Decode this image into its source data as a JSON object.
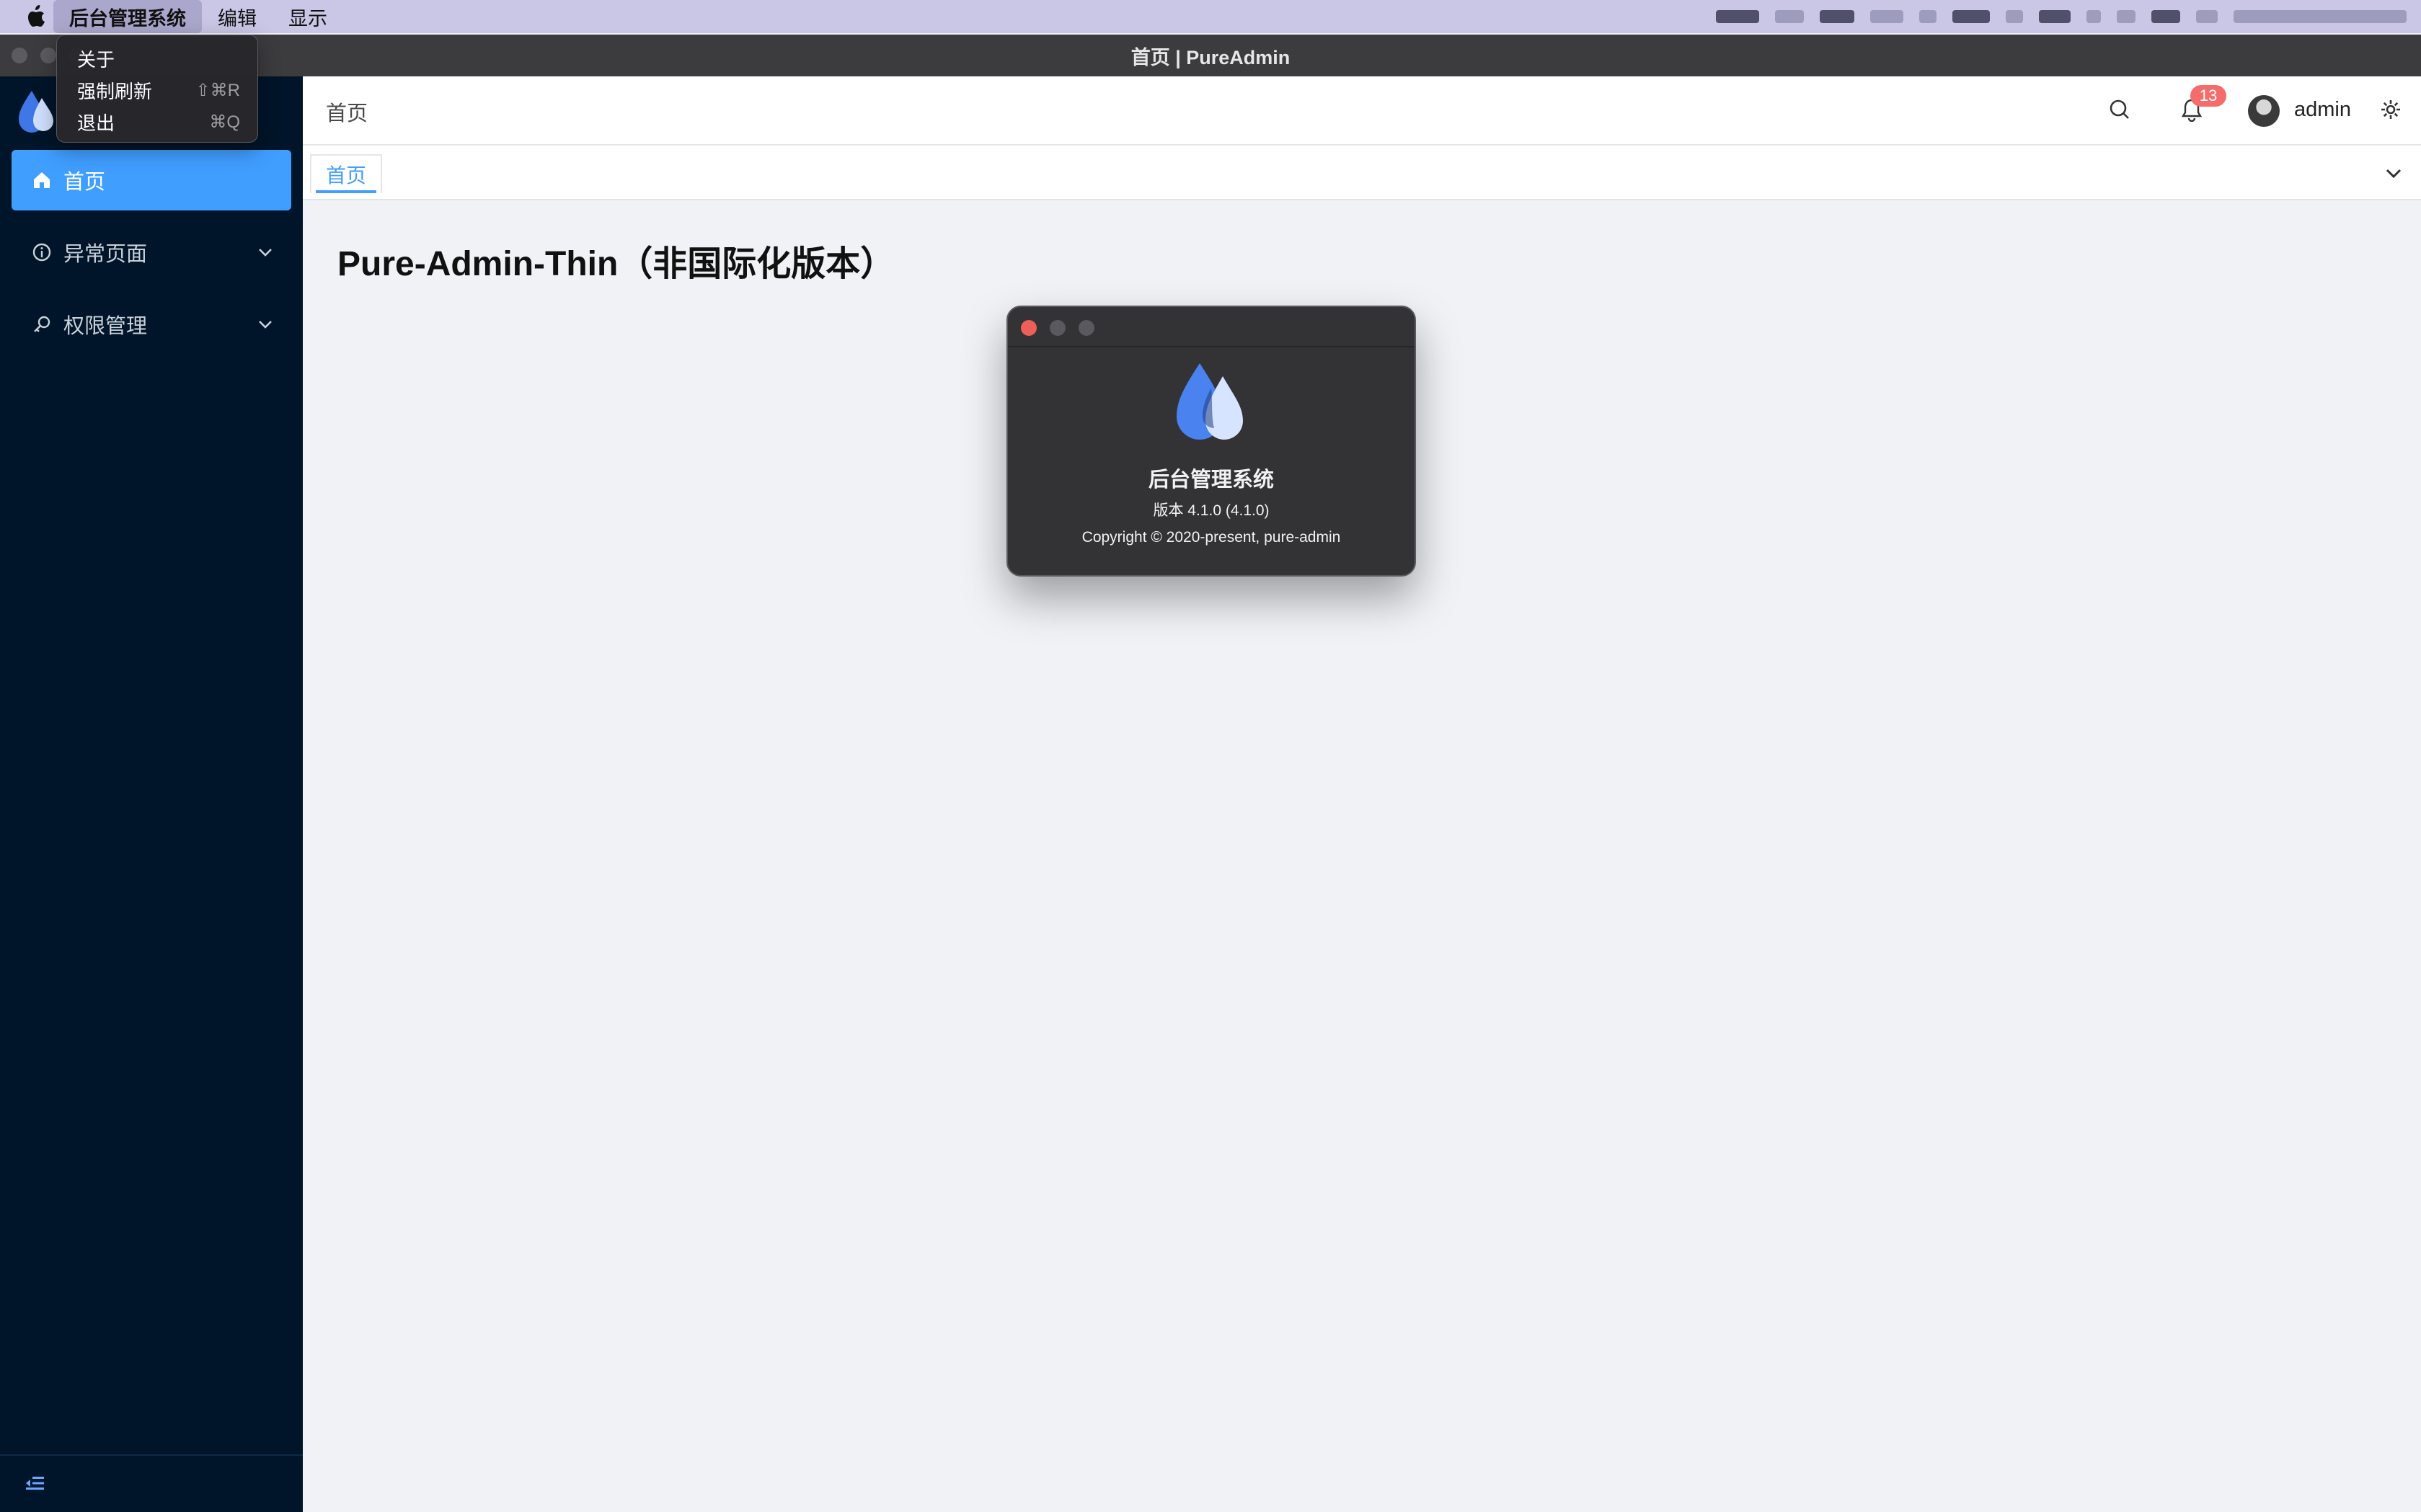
{
  "menubar": {
    "apple_icon": "apple-icon",
    "items": [
      "后台管理系统",
      "编辑",
      "显示"
    ]
  },
  "dropdown": {
    "items": [
      {
        "label": "关于",
        "shortcut": ""
      },
      {
        "label": "强制刷新",
        "shortcut": "⇧⌘R"
      },
      {
        "label": "退出",
        "shortcut": "⌘Q"
      }
    ]
  },
  "window": {
    "title": "首页 | PureAdmin"
  },
  "sidebar": {
    "items": [
      {
        "label": "首页",
        "icon": "home-icon",
        "active": true
      },
      {
        "label": "异常页面",
        "icon": "info-circle-icon",
        "active": false
      },
      {
        "label": "权限管理",
        "icon": "key-icon",
        "active": false
      }
    ],
    "collapse_icon": "collapse-menu-icon"
  },
  "header": {
    "breadcrumb": "首页",
    "notification_count": "13",
    "username": "admin"
  },
  "tabs": {
    "items": [
      "首页"
    ]
  },
  "main": {
    "title": "Pure-Admin-Thin（非国际化版本）"
  },
  "about": {
    "app_name": "后台管理系统",
    "version": "版本 4.1.0 (4.1.0)",
    "copyright": "Copyright © 2020-present, pure-admin"
  },
  "colors": {
    "accent": "#409eff",
    "sidebar_bg": "#001529",
    "badge": "#f56c6c",
    "menubar_bg": "#c9c6e6"
  }
}
